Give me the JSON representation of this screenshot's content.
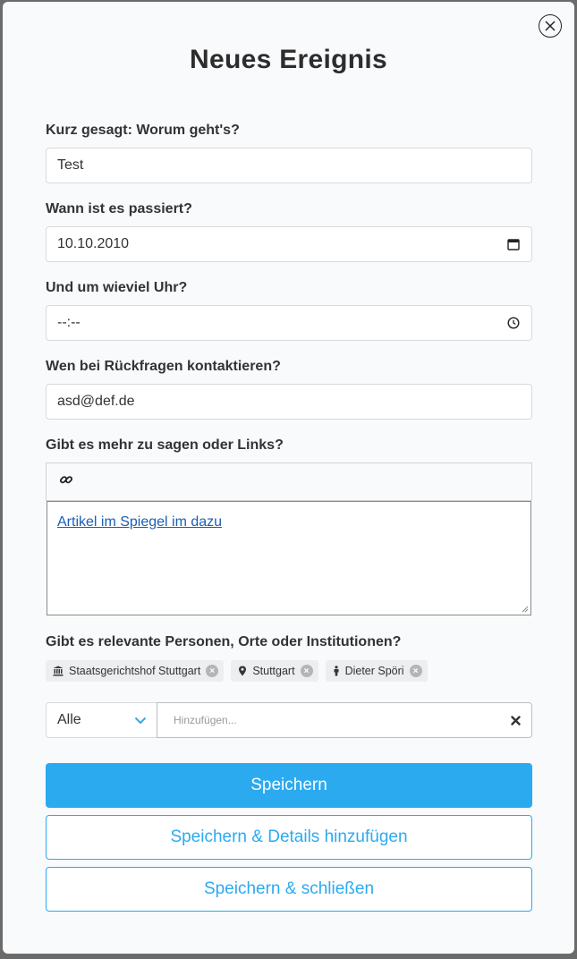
{
  "modal": {
    "title": "Neues Ereignis",
    "close_icon": "close-circle-icon"
  },
  "fields": {
    "summary": {
      "label": "Kurz gesagt: Worum geht's?",
      "value": "Test"
    },
    "date": {
      "label": "Wann ist es passiert?",
      "value": "10.10.2010",
      "icon": "calendar-icon"
    },
    "time": {
      "label": "Und um wieviel Uhr?",
      "value": "--:--",
      "icon": "clock-icon"
    },
    "contact": {
      "label": "Wen bei Rückfragen kontaktieren?",
      "value": "asd@def.de"
    },
    "details": {
      "label": "Gibt es mehr zu sagen oder Links?",
      "toolbar_icon": "link-icon",
      "link_text": "Artikel im Spiegel im dazu"
    }
  },
  "entities": {
    "label": "Gibt es relevante Personen, Orte oder Institutionen?",
    "tags": [
      {
        "icon": "institution-icon",
        "label": "Staatsgerichtshof Stuttgart"
      },
      {
        "icon": "location-pin-icon",
        "label": "Stuttgart"
      },
      {
        "icon": "person-icon",
        "label": "Dieter Spöri"
      }
    ],
    "filter_value": "Alle",
    "add_placeholder": "Hinzufügen...",
    "clear_icon": "clear-icon"
  },
  "buttons": {
    "save": "Speichern",
    "save_add_details": "Speichern & Details hinzufügen",
    "save_close": "Speichern & schließen"
  },
  "colors": {
    "accent": "#2baaf0",
    "background": "#f9fafb"
  }
}
